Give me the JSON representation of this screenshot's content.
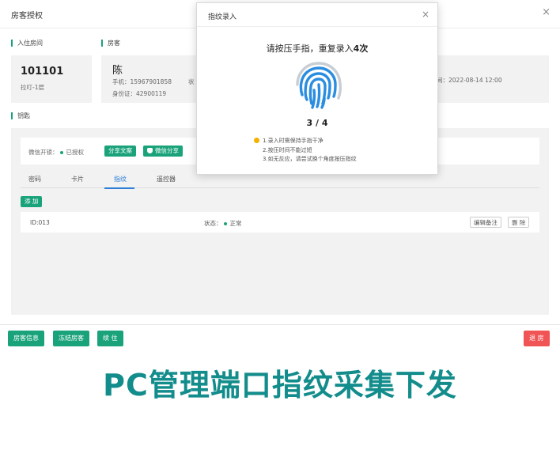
{
  "main": {
    "title": "房客授权",
    "close": "×",
    "sections": {
      "room": "入住房间",
      "guest": "房客",
      "keys": "钥匙"
    },
    "room": {
      "number": "101101",
      "location": "拉叮-1层"
    },
    "guest": {
      "name": "陈",
      "phone_label": "手机：",
      "phone": "15967901858",
      "status_label": "状",
      "id_label": "身份证：",
      "id": "42900119",
      "time_label": "间：",
      "time": "2022-08-14 12:00"
    },
    "keys": {
      "wechat_label": "微信开锁：",
      "wechat_status": "已授权",
      "share_text_button": "分享文案",
      "wechat_share_button": "微信分享",
      "tabs": [
        {
          "label": "密码"
        },
        {
          "label": "卡片"
        },
        {
          "label": "指纹"
        },
        {
          "label": "遥控器"
        }
      ],
      "active_tab": "指纹",
      "add_button": "添 加",
      "fingerprint": {
        "id": "ID:013",
        "state_label": "状态：",
        "state": "正常",
        "edit_button": "编辑备注",
        "delete_button": "删 除"
      }
    },
    "footer": {
      "guest_info": "房客信息",
      "freeze": "冻结房客",
      "extend": "续 住",
      "checkout": "退 房"
    }
  },
  "fingerprint_modal": {
    "title": "指纹录入",
    "close": "×",
    "instruction_prefix": "请按压手指，重复录入",
    "instruction_count": "4次",
    "progress": "3 / 4",
    "tips": [
      "1.录入时需保持手指干净",
      "2.按压时间不能过短",
      "3.如无反应，请尝试换个角度按压指纹"
    ]
  },
  "headline": "PC管理端口指纹采集下发",
  "colors": {
    "accent": "#1aa37a",
    "danger": "#f05454",
    "tab_active": "#2f7fd6",
    "headline": "#138c8c",
    "fingerprint": "#2a8de0",
    "tip": "#f5b100"
  },
  "icons": {
    "close": "close-icon",
    "fingerprint": "fingerprint-icon",
    "wechat": "shield-icon",
    "tip": "warning-icon"
  }
}
